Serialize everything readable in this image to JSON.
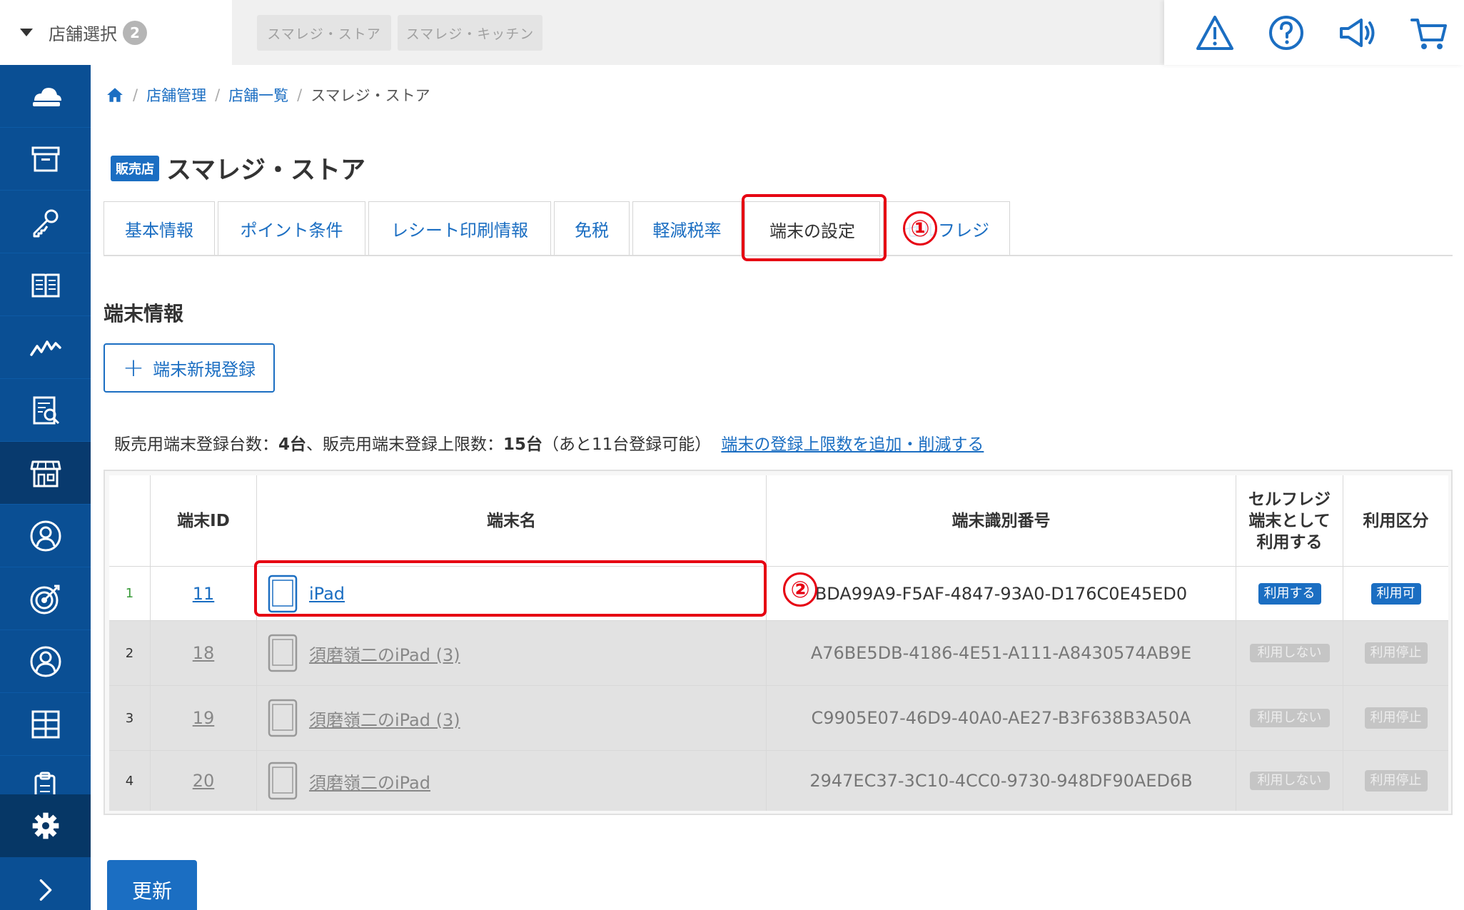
{
  "topbar": {
    "store_select_label": "店舗選択",
    "store_count": "2",
    "store_chips": [
      "スマレジ・ストア",
      "スマレジ・キッチン"
    ],
    "icons": [
      "warning-icon",
      "help-icon",
      "megaphone-icon",
      "cart-icon"
    ]
  },
  "sidebar": {
    "items": [
      "cloud-register-icon",
      "archive-icon",
      "key-icon",
      "book-icon",
      "analytics-icon",
      "report-icon",
      "store-icon",
      "customer-icon",
      "target-icon",
      "user-icon",
      "grid-icon",
      "clipboard-icon"
    ],
    "bottom": [
      "gear-icon",
      "chevron-right-icon"
    ]
  },
  "breadcrumb": {
    "items": [
      "店舗管理",
      "店舗一覧"
    ],
    "current": "スマレジ・ストア"
  },
  "page": {
    "badge": "販売店",
    "title": "スマレジ・ストア"
  },
  "tabs": [
    "基本情報",
    "ポイント条件",
    "レシート印刷情報",
    "免税",
    "軽減税率",
    "端末の設定",
    "セルフレジ"
  ],
  "annotations": {
    "marker1": "①",
    "marker2": "②"
  },
  "section": {
    "title": "端末情報",
    "new_button": "端末新規登録"
  },
  "info": {
    "label1": "販売用端末登録台数：",
    "count1": "4台",
    "label2": "、販売用端末登録上限数：",
    "count2": "15台",
    "note": "（あと11台登録可能）",
    "link": "端末の登録上限数を追加・削減する"
  },
  "table": {
    "headers": [
      "端末ID",
      "端末名",
      "端末識別番号",
      "セルフレジ端末として利用する",
      "利用区分"
    ],
    "header_self_lines": [
      "セルフレジ",
      "端末として",
      "利用する"
    ],
    "rows": [
      {
        "index": "1",
        "id": "11",
        "name": "iPad",
        "uuid": "BDA99A9-F5AF-4847-93A0-D176C0E45ED0",
        "self": "利用する",
        "status": "利用可"
      },
      {
        "index": "2",
        "id": "18",
        "name": "須磨嶺二のiPad (3)",
        "uuid": "A76BE5DB-4186-4E51-A111-A8430574AB9E",
        "self": "利用しない",
        "status": "利用停止"
      },
      {
        "index": "3",
        "id": "19",
        "name": "須磨嶺二のiPad (3)",
        "uuid": "C9905E07-46D9-40A0-AE27-B3F638B3A50A",
        "self": "利用しない",
        "status": "利用停止"
      },
      {
        "index": "4",
        "id": "20",
        "name": "須磨嶺二のiPad",
        "uuid": "2947EC37-3C10-4CC0-9730-948DF90AED6B",
        "self": "利用しない",
        "status": "利用停止"
      }
    ]
  },
  "footer": {
    "update_button": "更新"
  },
  "colors": {
    "sidebar": "#0a4f94",
    "accent": "#1b6ec2",
    "highlight": "#e60012"
  }
}
